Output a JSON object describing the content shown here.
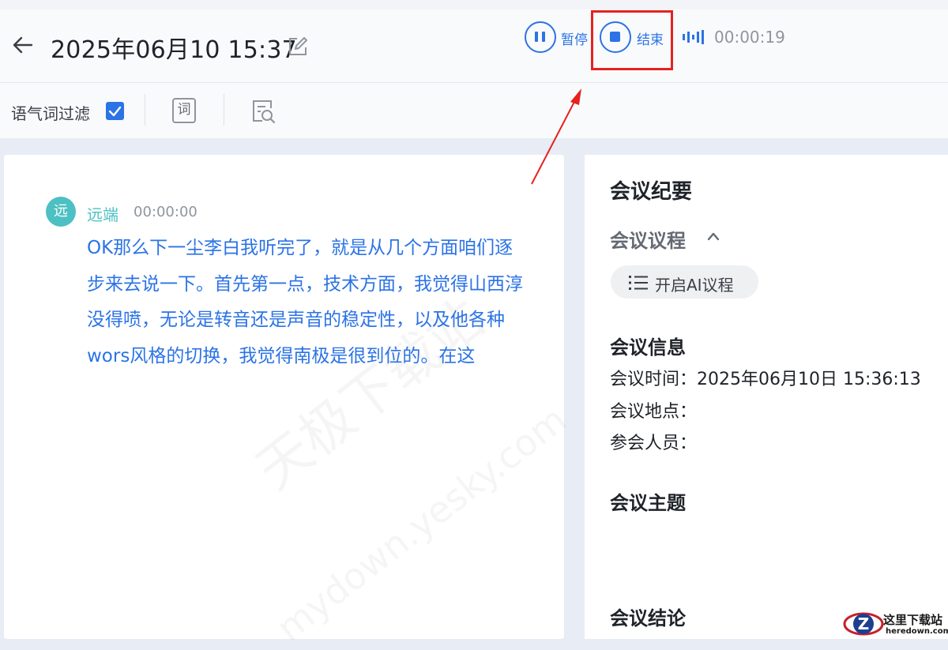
{
  "header": {
    "title": "2025年06月10 15:37",
    "pause_label": "暂停",
    "stop_label": "结束",
    "timer": "00:00:19"
  },
  "toolbar": {
    "filter_label": "语气词过滤",
    "filter_checked": true,
    "word_icon_glyph": "词"
  },
  "transcript": {
    "avatar_text": "远",
    "speaker": "远端",
    "time": "00:00:00",
    "text": "OK那么下一尘李白我听完了，就是从几个方面咱们逐步来去说一下。首先第一点，技术方面，我觉得山西淳没得喷，无论是转音还是声音的稳定性，以及他各种wors风格的切换，我觉得南极是很到位的。在这"
  },
  "summary": {
    "title": "会议纪要",
    "agenda_title": "会议议程",
    "ai_button": "开启AI议程",
    "info_title": "会议信息",
    "time_row": "会议时间：2025年06月10日 15:36:13",
    "place_row": "会议地点：",
    "people_row": "参会人员：",
    "topic_title": "会议主题",
    "conclusion_title": "会议结论"
  },
  "watermark": {
    "line1": "天极下载站",
    "line2": "mydown.yesky.com"
  },
  "logo": {
    "text": "这里下载站",
    "sub": "heredown.com"
  },
  "colors": {
    "accent": "#2b73e6",
    "highlight": "#e52220",
    "speaker": "#4cc0c2"
  }
}
